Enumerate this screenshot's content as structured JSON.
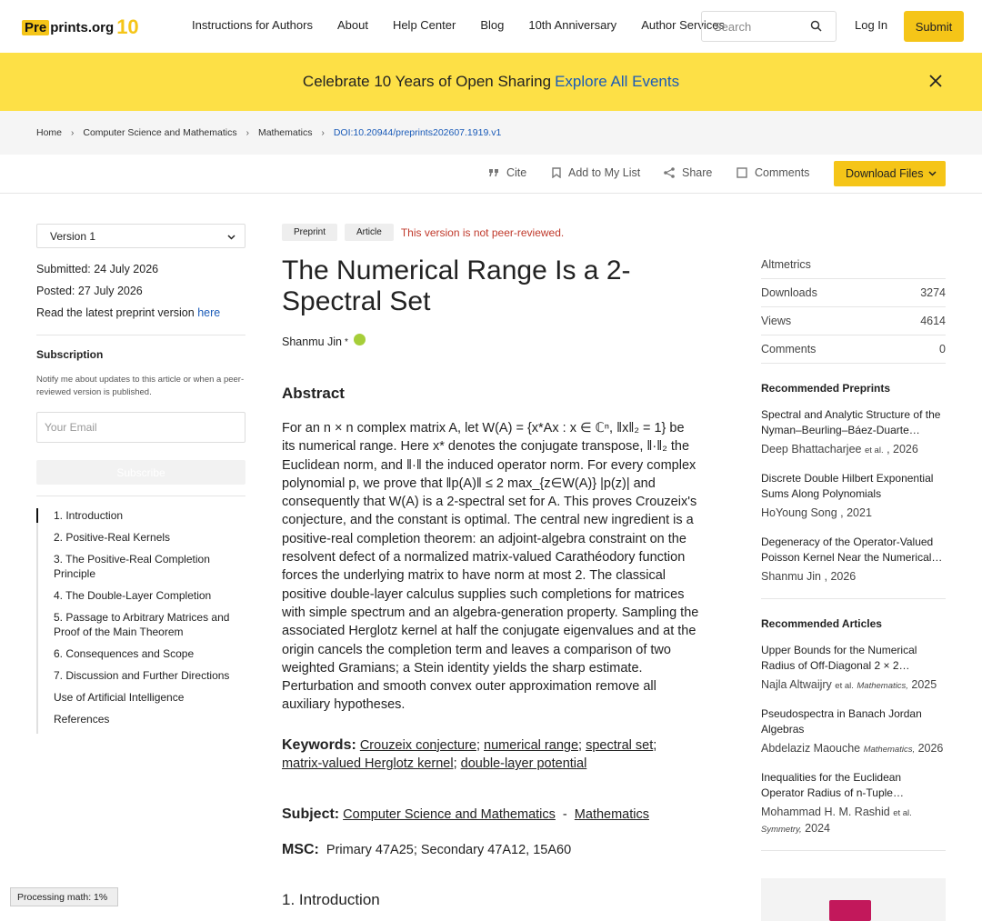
{
  "nav": {
    "logo_pre": "Pre",
    "logo_rest": "prints.org",
    "logo_badge": "10",
    "links": [
      "Instructions for Authors",
      "About",
      "Help Center",
      "Blog",
      "10th Anniversary",
      "Author Services"
    ],
    "search_placeholder": "Search",
    "login": "Log In",
    "submit": "Submit"
  },
  "banner": {
    "text": "Celebrate 10 Years of Open Sharing",
    "link": "Explore All Events"
  },
  "breadcrumb": [
    "Home",
    "Computer Science and Mathematics",
    "Mathematics",
    "DOI:10.20944/preprints202607.1919.v1"
  ],
  "toolbar": {
    "cite": "Cite",
    "add_list": "Add to My List",
    "share": "Share",
    "comments": "Comments",
    "download": "Download Files"
  },
  "sidebar": {
    "version": "Version 1",
    "submitted": "Submitted: 24 July 2026",
    "posted": "Posted: 27 July 2026",
    "latest_prefix": "Read the latest preprint version",
    "latest_link": "here",
    "subscription_title": "Subscription",
    "notify": "Notify me about updates to this article or when a peer-reviewed version is published.",
    "email_placeholder": "Your Email",
    "subscribe_button": "Subscribe",
    "toc": [
      "1. Introduction",
      "2. Positive-Real Kernels",
      "3. The Positive-Real Completion Principle",
      "4. The Double-Layer Completion",
      "5. Passage to Arbitrary Matrices and Proof of the Main Theorem",
      "6. Consequences and Scope",
      "7. Discussion and Further Directions",
      "Use of Artificial Intelligence",
      "References"
    ]
  },
  "article": {
    "tag_preprint": "Preprint",
    "tag_article": "Article",
    "not_reviewed": "This version is not peer-reviewed.",
    "title": "The Numerical Range Is a 2-Spectral Set",
    "author": "Shanmu Jin",
    "author_mark": "*",
    "abstract_heading": "Abstract",
    "abstract": "For an n × n complex matrix A, let W(A) = {x*Ax : x ∈ ℂⁿ, ‖x‖₂ = 1} be its numerical range. Here x* denotes the conjugate transpose, ‖·‖₂ the Euclidean norm, and ‖·‖ the induced operator norm. For every complex polynomial p, we prove that ‖p(A)‖ ≤ 2 max_{z∈W(A)} |p(z)| and consequently that W(A) is a 2-spectral set for A. This proves Crouzeix's conjecture, and the constant is optimal. The central new ingredient is a positive-real completion theorem: an adjoint-algebra constraint on the resolvent defect of a normalized matrix-valued Carathéodory function forces the underlying matrix to have norm at most 2. The classical positive double-layer calculus supplies such completions for matrices with simple spectrum and an algebra-generation property. Sampling the associated Herglotz kernel at half the conjugate eigenvalues and at the origin cancels the completion term and leaves a comparison of two weighted Gramians; a Stein identity yields the sharp estimate. Perturbation and smooth convex outer approximation remove all auxiliary hypotheses.",
    "keywords_label": "Keywords:",
    "keywords": [
      "Crouzeix conjecture",
      "numerical range",
      "spectral set",
      "matrix-valued Herglotz kernel",
      "double-layer potential"
    ],
    "subject_label": "Subject:",
    "subject_1": "Computer Science and Mathematics",
    "subject_sep": "-",
    "subject_2": "Mathematics",
    "msc_label": "MSC:",
    "msc": "Primary 47A25; Secondary 47A12, 15A60",
    "intro_heading": "1. Introduction"
  },
  "right": {
    "altmetrics": "Altmetrics",
    "stats": [
      {
        "label": "Downloads",
        "value": "3274"
      },
      {
        "label": "Views",
        "value": "4614"
      },
      {
        "label": "Comments",
        "value": "0"
      }
    ],
    "rec_preprints_title": "Recommended Preprints",
    "rec_preprints": [
      {
        "title": "Spectral and Analytic Structure of the Nyman–Beurling–Báez-Duarte…",
        "author": "Deep Bhattacharjee",
        "etal": "et al.",
        "year": ", 2026"
      },
      {
        "title": "Discrete Double Hilbert Exponential Sums Along Polynomials",
        "author": "HoYoung Song",
        "etal": "",
        "year": ", 2021"
      },
      {
        "title": "Degeneracy of the Operator-Valued Poisson Kernel Near the Numerical…",
        "author": "Shanmu Jin",
        "etal": "",
        "year": ", 2026"
      }
    ],
    "rec_articles_title": "Recommended Articles",
    "rec_articles": [
      {
        "title": "Upper Bounds for the Numerical Radius of Off-Diagonal 2 × 2…",
        "author": "Najla Altwaijry",
        "etal": "et al.",
        "journal": "Mathematics,",
        "year": "2025"
      },
      {
        "title": "Pseudospectra in Banach Jordan Algebras",
        "author": "Abdelaziz Maouche",
        "etal": "",
        "journal": "Mathematics,",
        "year": "2026"
      },
      {
        "title": "Inequalities for the Euclidean Operator Radius of n-Tuple…",
        "author": "Mohammad H. M. Rashid",
        "etal": "et al.",
        "journal": "Symmetry,",
        "year": "2024"
      }
    ]
  },
  "math_processing": "Processing math: 1%"
}
